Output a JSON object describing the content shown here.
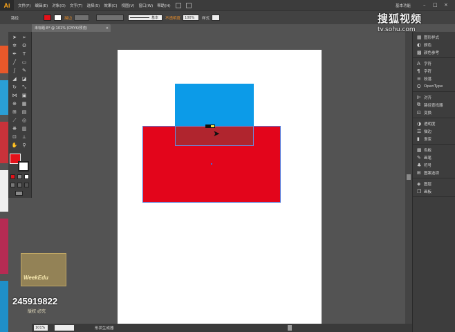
{
  "app": {
    "logo": "Ai",
    "workspace": "基本功能"
  },
  "menu": [
    "文件(F)",
    "编辑(E)",
    "对象(O)",
    "文字(T)",
    "选择(S)",
    "效果(C)",
    "视图(V)",
    "窗口(W)",
    "帮助(H)"
  ],
  "control_bar": {
    "selection_label": "路径",
    "stroke_label": "描边",
    "stroke_style": "基本",
    "opacity_label": "不透明度",
    "opacity_value": "100%",
    "style_label": "样式"
  },
  "document_tab": {
    "title": "未标题-8* @ 101% (CMYK/预览)",
    "close": "×"
  },
  "colors": {
    "fill": "#e3121a",
    "blue_shape": "#0c9be8",
    "red_shape": "#e3051b",
    "overlap": "#b0252e",
    "accent": "#f7a21b"
  },
  "status": {
    "zoom": "101%",
    "tool_name": "形状生成器"
  },
  "panels": [
    [
      {
        "icon": "pattern-icon",
        "label": "图形样式"
      },
      {
        "icon": "palette-icon",
        "label": "颜色"
      },
      {
        "icon": "color-guide-icon",
        "label": "颜色参考"
      }
    ],
    [
      {
        "icon": "type-icon",
        "label": "字符"
      },
      {
        "icon": "paragraph-icon",
        "label": "字符"
      },
      {
        "icon": "paragraph-icon",
        "label": "段落"
      },
      {
        "icon": "opentype-icon",
        "label": "OpenType"
      }
    ],
    [
      {
        "icon": "align-icon",
        "label": "对齐"
      },
      {
        "icon": "pathfinder-icon",
        "label": "路径查找器"
      },
      {
        "icon": "transform-icon",
        "label": "变换"
      }
    ],
    [
      {
        "icon": "transparency-icon",
        "label": "透明度"
      },
      {
        "icon": "stroke-icon",
        "label": "描边"
      },
      {
        "icon": "gradient-icon",
        "label": "渐变"
      }
    ],
    [
      {
        "icon": "swatches-icon",
        "label": "色板"
      },
      {
        "icon": "brushes-icon",
        "label": "画笔"
      },
      {
        "icon": "symbols-icon",
        "label": "符号"
      },
      {
        "icon": "graphic-styles-icon",
        "label": "图案选项"
      }
    ],
    [
      {
        "icon": "layers-icon",
        "label": "图层"
      },
      {
        "icon": "artboards-icon",
        "label": "画板"
      }
    ]
  ],
  "watermarks": {
    "top_big": "搜狐视频",
    "top_small": "tv.sohu.com",
    "logo_text": "WeekEdu",
    "number": "245919822",
    "sub": "版权   必究"
  }
}
